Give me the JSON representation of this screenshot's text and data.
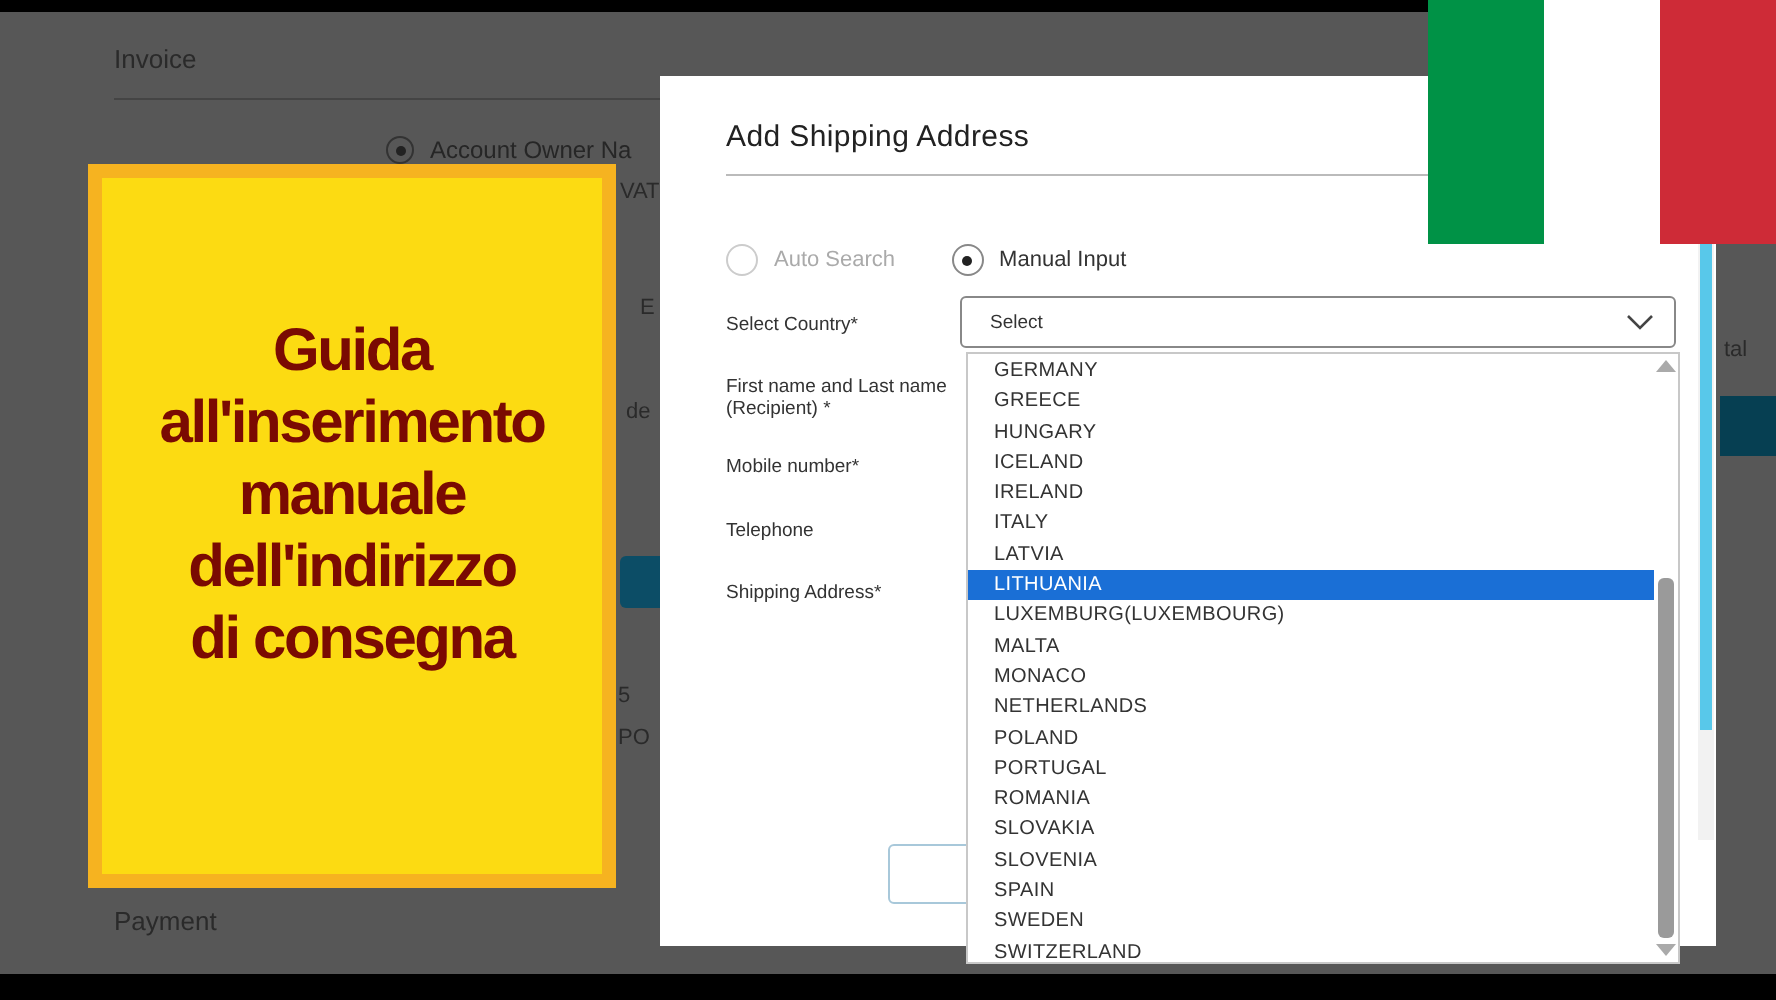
{
  "background_page": {
    "sections": [
      {
        "title": "Invoice"
      },
      {
        "title": "Payment"
      }
    ],
    "account_option": {
      "label": "Account Owner Na",
      "selected": true
    },
    "fragments": [
      "VAT",
      "E",
      "de",
      "5",
      "PO",
      "tal"
    ]
  },
  "dialog": {
    "title": "Add Shipping Address",
    "mode_options": [
      {
        "label": "Auto Search",
        "selected": false
      },
      {
        "label": "Manual Input",
        "selected": true
      }
    ],
    "fields": [
      {
        "label": "Select Country*",
        "kind": "select",
        "value": "Select"
      },
      {
        "label": "First name and Last name (Recipient) *",
        "kind": "text"
      },
      {
        "label": "Mobile number*",
        "kind": "text"
      },
      {
        "label": "Telephone",
        "kind": "text"
      },
      {
        "label": "Shipping Address*",
        "kind": "text"
      }
    ],
    "country_dropdown": {
      "options": [
        {
          "label": "GERMANY",
          "selected": false
        },
        {
          "label": "GREECE",
          "selected": false
        },
        {
          "label": "HUNGARY",
          "selected": false
        },
        {
          "label": "ICELAND",
          "selected": false
        },
        {
          "label": "IRELAND",
          "selected": false
        },
        {
          "label": "ITALY",
          "selected": false
        },
        {
          "label": "LATVIA",
          "selected": false
        },
        {
          "label": "LITHUANIA",
          "selected": true
        },
        {
          "label": "LUXEMBURG(LUXEMBOURG)",
          "selected": false
        },
        {
          "label": "MALTA",
          "selected": false
        },
        {
          "label": "MONACO",
          "selected": false
        },
        {
          "label": "NETHERLANDS",
          "selected": false
        },
        {
          "label": "POLAND",
          "selected": false
        },
        {
          "label": "PORTUGAL",
          "selected": false
        },
        {
          "label": "ROMANIA",
          "selected": false
        },
        {
          "label": "SLOVAKIA",
          "selected": false
        },
        {
          "label": "SLOVENIA",
          "selected": false
        },
        {
          "label": "SPAIN",
          "selected": false
        },
        {
          "label": "SWEDEN",
          "selected": false
        },
        {
          "label": "SWITZERLAND",
          "selected": false
        }
      ]
    }
  },
  "banner": {
    "lines": [
      "Guida",
      "all'inserimento",
      "manuale",
      "dell'indirizzo",
      "di consegna"
    ]
  }
}
